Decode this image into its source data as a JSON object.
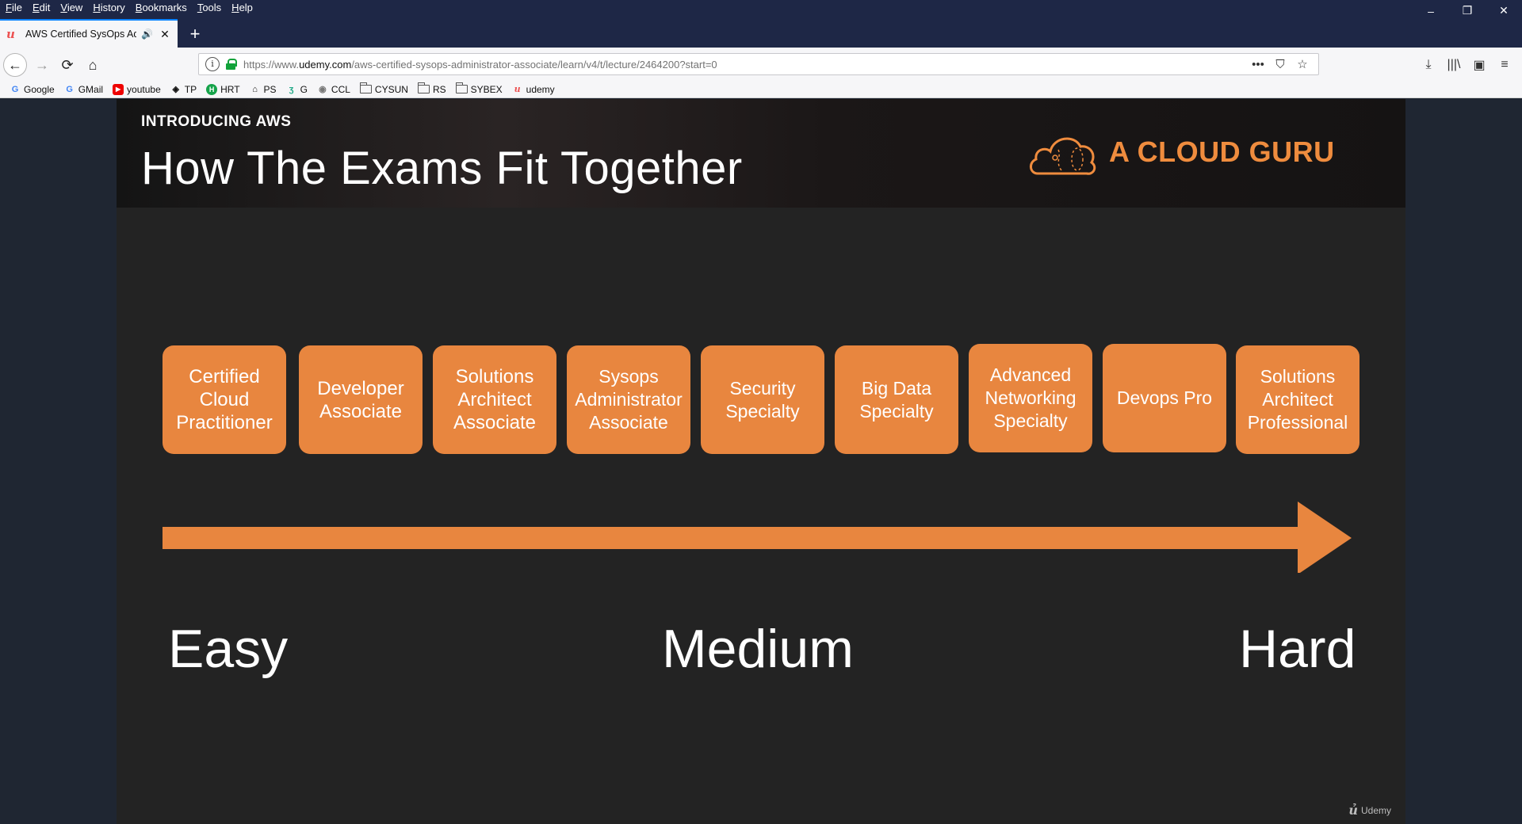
{
  "menu": [
    "File",
    "Edit",
    "View",
    "History",
    "Bookmarks",
    "Tools",
    "Help"
  ],
  "window_controls": {
    "minimize": "–",
    "restore": "❐",
    "close": "✕"
  },
  "tab": {
    "favicon": "u",
    "title": "AWS Certified SysOps Admi",
    "new_tab": "+"
  },
  "nav": {
    "back": "←",
    "forward": "→",
    "reload": "⟳",
    "home": "⌂"
  },
  "url": {
    "prefix": "https://www.",
    "host": "udemy.com",
    "path": "/aws-certified-sysops-administrator-associate/learn/v4/t/lecture/2464200?start=0",
    "info": "i",
    "actions": [
      "•••",
      "⛉",
      "☆"
    ]
  },
  "toolbar_right": [
    "⤓",
    "|||\\",
    "▣",
    "≡"
  ],
  "bookmarks": [
    {
      "label": "Google",
      "icon": "G",
      "type": "g"
    },
    {
      "label": "GMail",
      "icon": "G",
      "type": "g"
    },
    {
      "label": "youtube",
      "icon": "▶",
      "type": "yt"
    },
    {
      "label": "TP",
      "icon": "◈",
      "type": "plain"
    },
    {
      "label": "HRT",
      "icon": "H",
      "type": "hrt"
    },
    {
      "label": "PS",
      "icon": "⌂",
      "type": "plain"
    },
    {
      "label": "G",
      "icon": "ʒ",
      "type": "plain"
    },
    {
      "label": "CCL",
      "icon": "◉",
      "type": "plain"
    },
    {
      "label": "CYSUN",
      "icon": "",
      "type": "folder"
    },
    {
      "label": "RS",
      "icon": "",
      "type": "folder"
    },
    {
      "label": "SYBEX",
      "icon": "",
      "type": "folder"
    },
    {
      "label": "udemy",
      "icon": "u",
      "type": "udemy"
    }
  ],
  "slide": {
    "kicker": "INTRODUCING AWS",
    "title": "How The Exams Fit Together",
    "brand": "A CLOUD GURU",
    "exams": [
      "Certified\nCloud\nPractitioner",
      "Developer\nAssociate",
      "Solutions\nArchitect\nAssociate",
      "Sysops\nAdministrator\nAssociate",
      "Security\nSpecialty",
      "Big Data\nSpecialty",
      "Advanced\nNetworking\nSpecialty",
      "Devops Pro",
      "Solutions\nArchitect\nProfessional"
    ],
    "difficulty": {
      "easy": "Easy",
      "medium": "Medium",
      "hard": "Hard"
    },
    "watermark": "Udemy",
    "accent_color": "#e8863f"
  }
}
